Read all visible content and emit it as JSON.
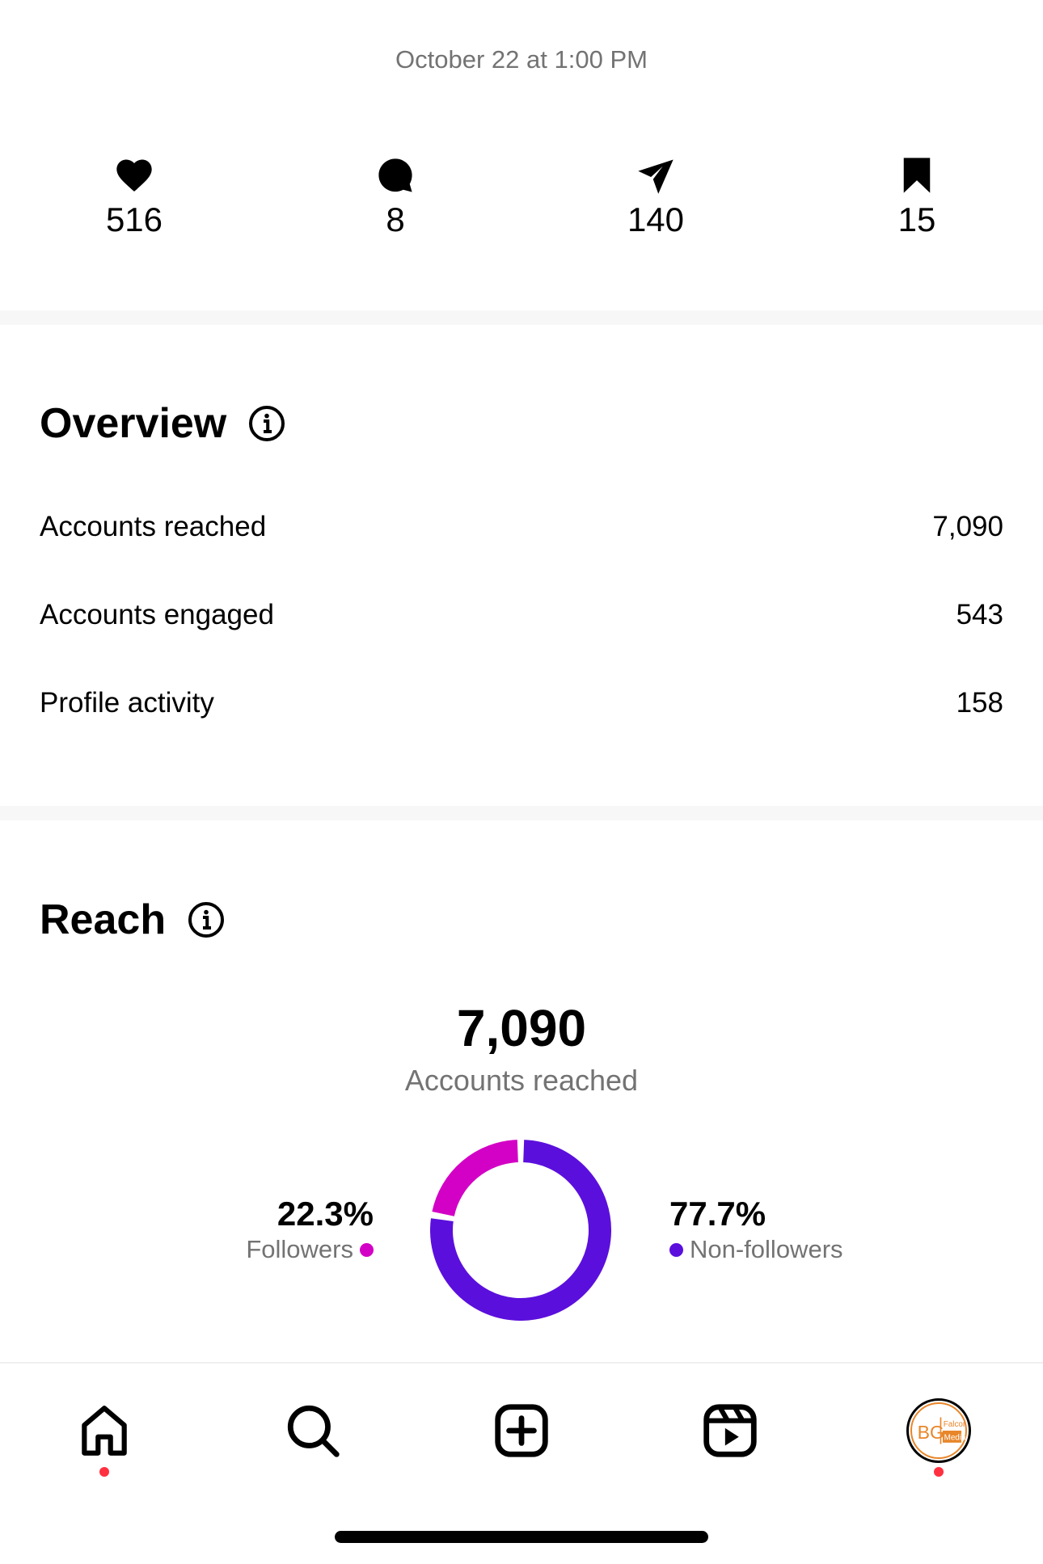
{
  "post": {
    "timestamp": "October 22 at 1:00 PM"
  },
  "stats": [
    {
      "icon": "heart-icon",
      "value": "516"
    },
    {
      "icon": "comment-icon",
      "value": "8"
    },
    {
      "icon": "share-icon",
      "value": "140"
    },
    {
      "icon": "bookmark-icon",
      "value": "15"
    }
  ],
  "overview": {
    "title": "Overview",
    "rows": [
      {
        "label": "Accounts reached",
        "value": "7,090"
      },
      {
        "label": "Accounts engaged",
        "value": "543"
      },
      {
        "label": "Profile activity",
        "value": "158"
      }
    ]
  },
  "reach": {
    "title": "Reach",
    "total": "7,090",
    "caption": "Accounts reached",
    "followers": {
      "pct": "22.3%",
      "label": "Followers",
      "fraction": 0.223,
      "color": "#d300c5"
    },
    "non_followers": {
      "pct": "77.7%",
      "label": "Non-followers",
      "fraction": 0.777,
      "color": "#5b0fdc"
    }
  },
  "nav": {
    "items": [
      "home-icon",
      "search-icon",
      "create-icon",
      "reels-icon",
      "profile-avatar"
    ],
    "badge_color": "#ff3040"
  }
}
